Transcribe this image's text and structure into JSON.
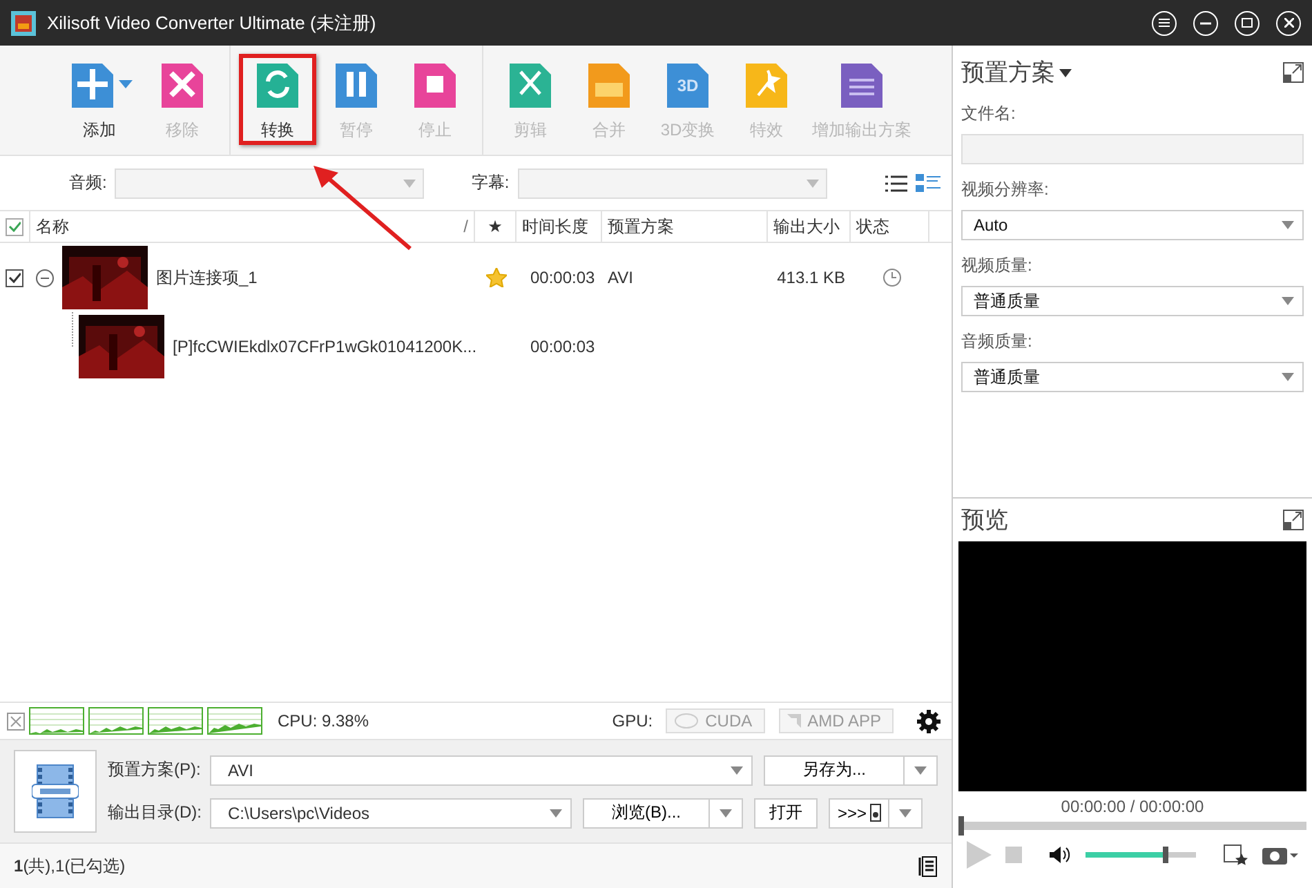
{
  "window": {
    "title": "Xilisoft Video Converter Ultimate (未注册)"
  },
  "toolbar": {
    "groups": [
      [
        {
          "label": "添加",
          "kind": "add",
          "color": "#3d8fd6",
          "disabled": false,
          "highlighted": false
        },
        {
          "label": "移除",
          "kind": "remove",
          "color": "#e8449a",
          "disabled": true,
          "highlighted": false
        }
      ],
      [
        {
          "label": "转换",
          "kind": "convert",
          "color": "#25b195",
          "disabled": false,
          "highlighted": true
        },
        {
          "label": "暂停",
          "kind": "pause",
          "color": "#3d8fd6",
          "disabled": true,
          "highlighted": false
        },
        {
          "label": "停止",
          "kind": "stop",
          "color": "#e8449a",
          "disabled": true,
          "highlighted": false
        }
      ],
      [
        {
          "label": "剪辑",
          "kind": "clip",
          "color": "#2bb394",
          "disabled": true,
          "highlighted": false
        },
        {
          "label": "合并",
          "kind": "merge",
          "color": "#f29a1c",
          "disabled": true,
          "highlighted": false
        },
        {
          "label": "3D变换",
          "kind": "stereo",
          "color": "#3d8fd6",
          "disabled": true,
          "highlighted": false,
          "glyph": "3D"
        },
        {
          "label": "特效",
          "kind": "effect",
          "color": "#f7b719",
          "disabled": true,
          "highlighted": false
        },
        {
          "label": "增加输出方案",
          "kind": "profile",
          "color": "#7a5fc0",
          "disabled": true,
          "highlighted": false
        }
      ]
    ]
  },
  "filters": {
    "audio_label": "音频:",
    "subtitle_label": "字幕:",
    "view_buttons": [
      {
        "kind": "list",
        "selected": false
      },
      {
        "kind": "detail",
        "selected": true
      }
    ]
  },
  "table": {
    "columns": [
      {
        "label": "名称"
      },
      {
        "label": "/"
      },
      {
        "label": "★"
      },
      {
        "label": "时间长度"
      },
      {
        "label": "预置方案"
      },
      {
        "label": "输出大小"
      },
      {
        "label": "状态"
      }
    ],
    "all_checked": true,
    "rows": [
      {
        "kind": "group",
        "checked": true,
        "expanded": true,
        "name": "图片连接项_1",
        "starred": true,
        "duration": "00:00:03",
        "profile": "AVI",
        "size": "413.1 KB",
        "waiting": true
      },
      {
        "kind": "child",
        "name": "[P]fcCWIEkdlx07CFrP1wGk01041200K...",
        "duration": "00:00:03"
      }
    ]
  },
  "monitor": {
    "cpu": "CPU: 9.38%",
    "gpu_label": "GPU:",
    "cuda": "CUDA",
    "amd": "AMD APP"
  },
  "output": {
    "profile_label": "预置方案(P):",
    "profile": "AVI",
    "save_as": "另存为...",
    "dir_label": "输出目录(D):",
    "dir": "C:\\Users\\pc\\Videos",
    "browse": "浏览(B)...",
    "open": "打开",
    "transfer": ">>>"
  },
  "status_bar": {
    "count": "1",
    "count_suffix": "(共),1(已勾选)"
  },
  "profile_panel": {
    "title": "预置方案",
    "file_label": "文件名:",
    "resolution_label": "视频分辨率:",
    "resolution": "Auto",
    "video_quality_label": "视频质量:",
    "video_quality": "普通质量",
    "audio_quality_label": "音频质量:",
    "audio_quality": "普通质量"
  },
  "preview": {
    "title": "预览",
    "time": "00:00:00 / 00:00:00",
    "seek": {
      "level": 0
    },
    "volume": {
      "level": 0.7
    }
  }
}
